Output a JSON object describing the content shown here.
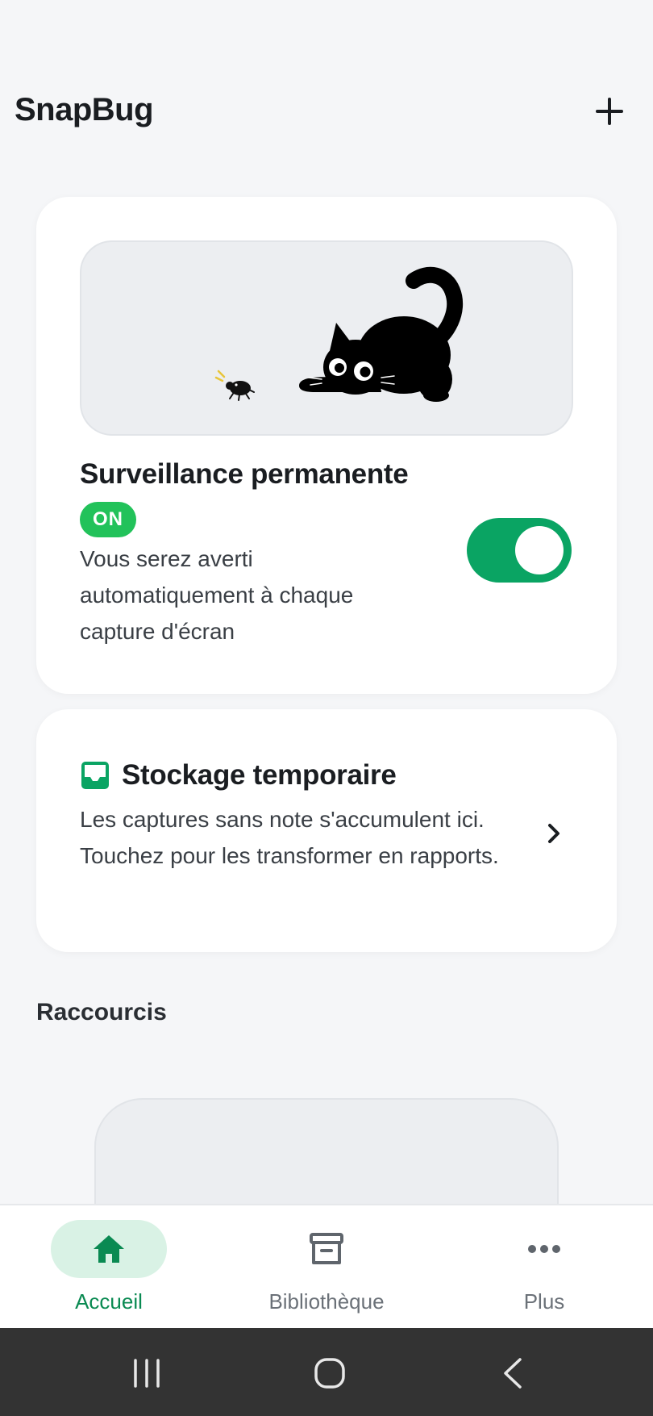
{
  "header": {
    "app_title": "SnapBug",
    "add_icon": "plus-icon"
  },
  "monitor_card": {
    "illustration": "cat-chasing-bug-illustration",
    "title": "Surveillance permanente",
    "badge": "ON",
    "description": "Vous serez averti automatiquement à chaque capture d'écran",
    "toggle_on": true
  },
  "storage_card": {
    "icon": "inbox-icon",
    "title": "Stockage temporaire",
    "description": "Les captures sans note s'accumulent ici. Touchez pour les transformer en rapports.",
    "chevron": "chevron-right-icon"
  },
  "shortcuts": {
    "title": "Raccourcis"
  },
  "bottom_nav": {
    "items": [
      {
        "label": "Accueil",
        "icon": "home-icon",
        "active": true
      },
      {
        "label": "Bibliothèque",
        "icon": "archive-icon",
        "active": false
      },
      {
        "label": "Plus",
        "icon": "more-horizontal-icon",
        "active": false
      }
    ]
  },
  "system_nav": {
    "recent": "recent-apps-icon",
    "home": "home-circle-icon",
    "back": "back-icon"
  },
  "colors": {
    "accent": "#0aa463",
    "badge": "#22c25a",
    "active_nav": "#0a8a52",
    "active_pill": "#d9f2e5"
  }
}
